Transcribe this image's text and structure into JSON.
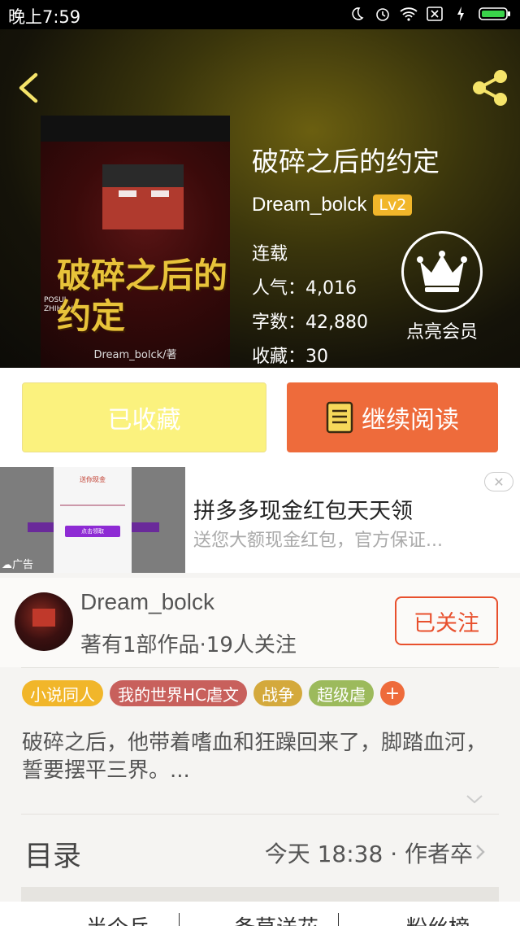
{
  "status_bar": {
    "time": "晚上7:59"
  },
  "book": {
    "cover_title": "破碎之后的约定",
    "cover_pinyin_1": "POSUI",
    "cover_pinyin_2": "ZHIHOU",
    "cover_author": "Dream_bolck/著",
    "title": "破碎之后的约定",
    "author": "Dream_bolck",
    "level": "Lv2",
    "status": "连载",
    "popularity": "人气：4,016",
    "word_count": "字数：42,880",
    "favorites": "收藏：30",
    "vip_label": "点亮会员"
  },
  "actions": {
    "collected_label": "已收藏",
    "read_label": "继续阅读"
  },
  "ad": {
    "image_title": "送你现金",
    "image_button": "点击领取",
    "tag": "广告",
    "title": "拼多多现金红包天天领",
    "description": "送您大额现金红包，官方保证...",
    "close": "✕"
  },
  "author_card": {
    "name": "Dream_bolck",
    "stats": "著有1部作品·19人关注",
    "follow_label": "已关注"
  },
  "tags": [
    {
      "label": "小说同人",
      "color": "#f1b62a"
    },
    {
      "label": "我的世界HC虐文",
      "color": "#c8605c"
    },
    {
      "label": "战争",
      "color": "#d4a93c"
    },
    {
      "label": "超级虐",
      "color": "#9cba5c"
    }
  ],
  "tag_add": "+",
  "description": "破碎之后，他带着嗜血和狂躁回来了，脚踏血河，誓要摆平三界。...",
  "toc": {
    "title": "目录",
    "update": "今天 18:38 · 作者卒"
  },
  "bottom_nav": [
    "半个兵",
    "备草送花",
    "粉丝榜"
  ],
  "colors": {
    "accent": "#ee6b3b",
    "follow": "#e8502d",
    "collected": "#fbf27e"
  }
}
